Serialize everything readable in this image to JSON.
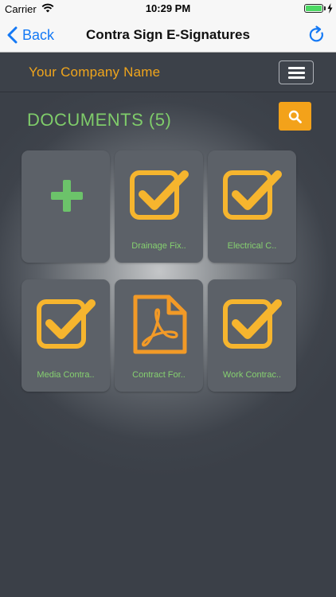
{
  "status_bar": {
    "carrier": "Carrier",
    "time": "10:29 PM"
  },
  "nav": {
    "back_label": "Back",
    "title": "Contra Sign E-Signatures"
  },
  "header": {
    "company_name": "Your Company Name"
  },
  "documents": {
    "heading": "DOCUMENTS (5)",
    "tiles": [
      {
        "label": "",
        "icon": "add-icon"
      },
      {
        "label": "Drainage Fix..",
        "icon": "checkmark-icon"
      },
      {
        "label": "Electrical C..",
        "icon": "checkmark-icon"
      },
      {
        "label": "Media Contra..",
        "icon": "checkmark-icon"
      },
      {
        "label": "Contract For..",
        "icon": "pdf-icon"
      },
      {
        "label": "Work Contrac..",
        "icon": "checkmark-icon"
      }
    ]
  },
  "colors": {
    "accent_orange": "#f3a21a",
    "label_green": "#86d070",
    "add_green": "#6cc36a",
    "ios_blue": "#1479f5",
    "background": "#3b4048",
    "tile": "#5c6168"
  }
}
